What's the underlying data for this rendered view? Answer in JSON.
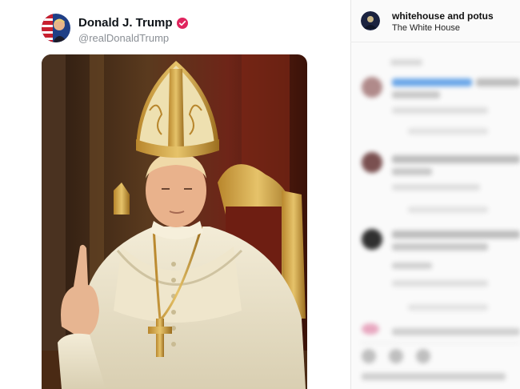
{
  "post": {
    "display_name": "Donald J. Trump",
    "handle": "@realDonaldTrump",
    "verified_icon": "verified-badge-icon",
    "image_icon": "pope-portrait-image",
    "verified_color": "#e0245e"
  },
  "instagram": {
    "username": "whitehouse and potus",
    "subtitle": "The White House"
  },
  "colors": {
    "text": "#0f1419",
    "muted": "#8a8f95"
  }
}
